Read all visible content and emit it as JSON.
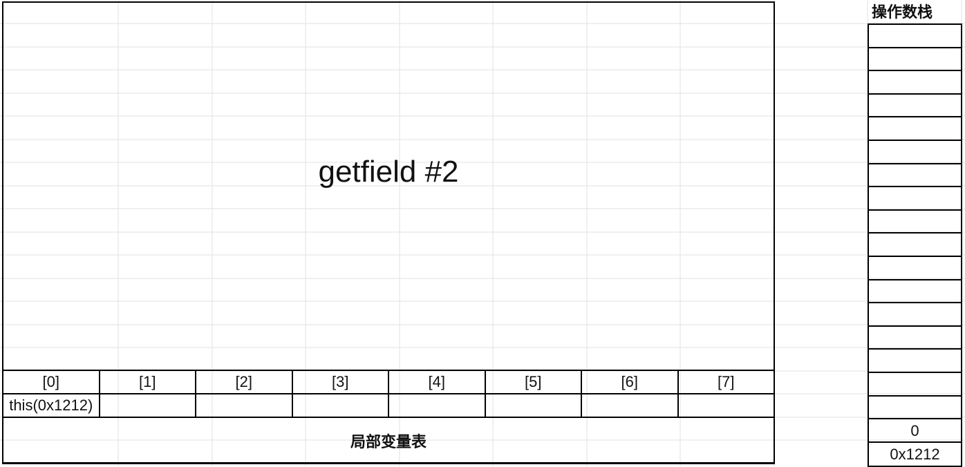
{
  "instruction": "getfield #2",
  "local_variable_table": {
    "caption": "局部变量表",
    "indices": [
      "[0]",
      "[1]",
      "[2]",
      "[3]",
      "[4]",
      "[5]",
      "[6]",
      "[7]"
    ],
    "values": [
      "this(0x1212)",
      "",
      "",
      "",
      "",
      "",
      "",
      ""
    ]
  },
  "operand_stack": {
    "title": "操作数栈",
    "cells": [
      "",
      "",
      "",
      "",
      "",
      "",
      "",
      "",
      "",
      "",
      "",
      "",
      "",
      "",
      "",
      "",
      "",
      "0",
      "0x1212"
    ]
  }
}
